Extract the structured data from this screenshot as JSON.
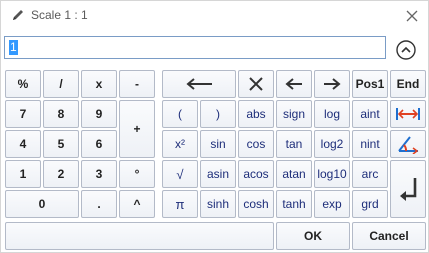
{
  "title": {
    "text": "Scale  1 : 1"
  },
  "input": {
    "value": "1"
  },
  "icons": {
    "title": "pencil-icon",
    "close": "close-icon",
    "collapse": "chevron-up-icon",
    "back": "long-left-arrow-icon",
    "clear": "clear-x-icon",
    "left": "left-arrow-icon",
    "right": "right-arrow-icon",
    "measure": "measure-distance-icon",
    "angle": "measure-angle-icon",
    "enter": "enter-icon"
  },
  "keys": {
    "pct": "%",
    "div": "/",
    "mul": "x",
    "sub": "-",
    "add": "+",
    "n7": "7",
    "n8": "8",
    "n9": "9",
    "n4": "4",
    "n5": "5",
    "n6": "6",
    "n1": "1",
    "n2": "2",
    "n3": "3",
    "n0": "0",
    "dot": ".",
    "deg": "°",
    "pow": "^",
    "pos1": "Pos1",
    "end": "End",
    "lpar": "(",
    "rpar": ")",
    "abs": "abs",
    "sign": "sign",
    "log": "log",
    "aint": "aint",
    "sq": "x²",
    "sin": "sin",
    "cos": "cos",
    "tan": "tan",
    "log2": "log2",
    "nint": "nint",
    "sqrt": "√",
    "asin": "asin",
    "acos": "acos",
    "atan": "atan",
    "log10": "log10",
    "arc": "arc",
    "pi": "π",
    "sinh": "sinh",
    "cosh": "cosh",
    "tanh": "tanh",
    "exp": "exp",
    "grd": "grd"
  },
  "buttons": {
    "ok": "OK",
    "cancel": "Cancel"
  },
  "colors": {
    "accent": "#1f6fcf",
    "key_text": "#1e2e6e",
    "border": "#b3bac8"
  }
}
